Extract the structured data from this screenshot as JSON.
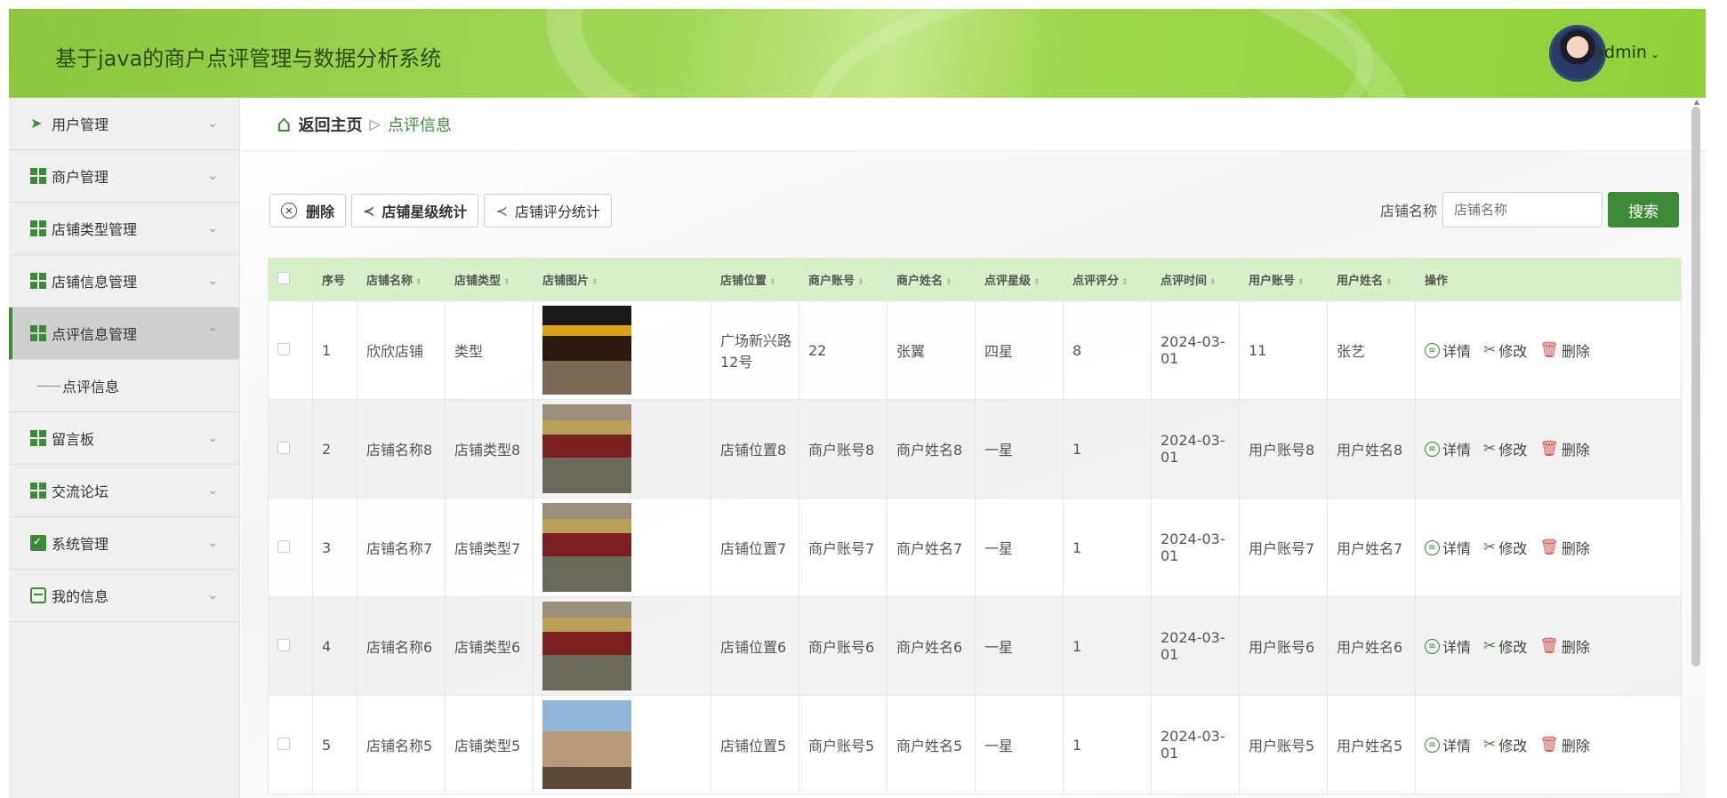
{
  "header": {
    "title": "基于java的商户点评管理与数据分析系统",
    "user": "admin"
  },
  "sidebar": {
    "items": [
      {
        "label": "用户管理",
        "icon": "paper-plane-icon"
      },
      {
        "label": "商户管理",
        "icon": "grid-icon"
      },
      {
        "label": "店铺类型管理",
        "icon": "grid-icon"
      },
      {
        "label": "店铺信息管理",
        "icon": "grid-icon"
      },
      {
        "label": "点评信息管理",
        "icon": "grid-icon",
        "active": true
      },
      {
        "label": "留言板",
        "icon": "grid-icon"
      },
      {
        "label": "交流论坛",
        "icon": "grid-icon"
      },
      {
        "label": "系统管理",
        "icon": "clipboard-check-icon"
      },
      {
        "label": "我的信息",
        "icon": "card-icon"
      }
    ],
    "sub_item": "点评信息"
  },
  "breadcrumb": {
    "home": "返回主页",
    "separator": "▷",
    "current": "点评信息"
  },
  "toolbar": {
    "delete_label": "删除",
    "star_stats_label": "店铺星级统计",
    "score_stats_label": "店铺评分统计"
  },
  "search": {
    "label": "店铺名称",
    "placeholder": "店铺名称",
    "button": "搜索"
  },
  "table": {
    "columns": [
      "序号",
      "店铺名称",
      "店铺类型",
      "店铺图片",
      "店铺位置",
      "商户账号",
      "商户姓名",
      "点评星级",
      "点评评分",
      "点评时间",
      "用户账号",
      "用户姓名",
      "操作"
    ],
    "rows": [
      {
        "no": "1",
        "shop_name": "欣欣店铺",
        "shop_type": "类型",
        "location": "广场新兴路12号",
        "merchant_account": "22",
        "merchant_name": "张翼",
        "stars": "四星",
        "score": "8",
        "time": "2024-03-01",
        "user_account": "11",
        "user_name": "张艺"
      },
      {
        "no": "2",
        "shop_name": "店铺名称8",
        "shop_type": "店铺类型8",
        "location": "店铺位置8",
        "merchant_account": "商户账号8",
        "merchant_name": "商户姓名8",
        "stars": "一星",
        "score": "1",
        "time": "2024-03-01",
        "user_account": "用户账号8",
        "user_name": "用户姓名8"
      },
      {
        "no": "3",
        "shop_name": "店铺名称7",
        "shop_type": "店铺类型7",
        "location": "店铺位置7",
        "merchant_account": "商户账号7",
        "merchant_name": "商户姓名7",
        "stars": "一星",
        "score": "1",
        "time": "2024-03-01",
        "user_account": "用户账号7",
        "user_name": "用户姓名7"
      },
      {
        "no": "4",
        "shop_name": "店铺名称6",
        "shop_type": "店铺类型6",
        "location": "店铺位置6",
        "merchant_account": "商户账号6",
        "merchant_name": "商户姓名6",
        "stars": "一星",
        "score": "1",
        "time": "2024-03-01",
        "user_account": "用户账号6",
        "user_name": "用户姓名6"
      },
      {
        "no": "5",
        "shop_name": "店铺名称5",
        "shop_type": "店铺类型5",
        "location": "店铺位置5",
        "merchant_account": "商户账号5",
        "merchant_name": "商户姓名5",
        "stars": "一星",
        "score": "1",
        "time": "2024-03-01",
        "user_account": "用户账号5",
        "user_name": "用户姓名5"
      }
    ],
    "actions": {
      "detail": "详情",
      "edit": "修改",
      "delete": "删除"
    }
  },
  "colors": {
    "accent": "#3d8b37",
    "header_green": "#8cc63f",
    "table_header": "#d7f0c8"
  }
}
